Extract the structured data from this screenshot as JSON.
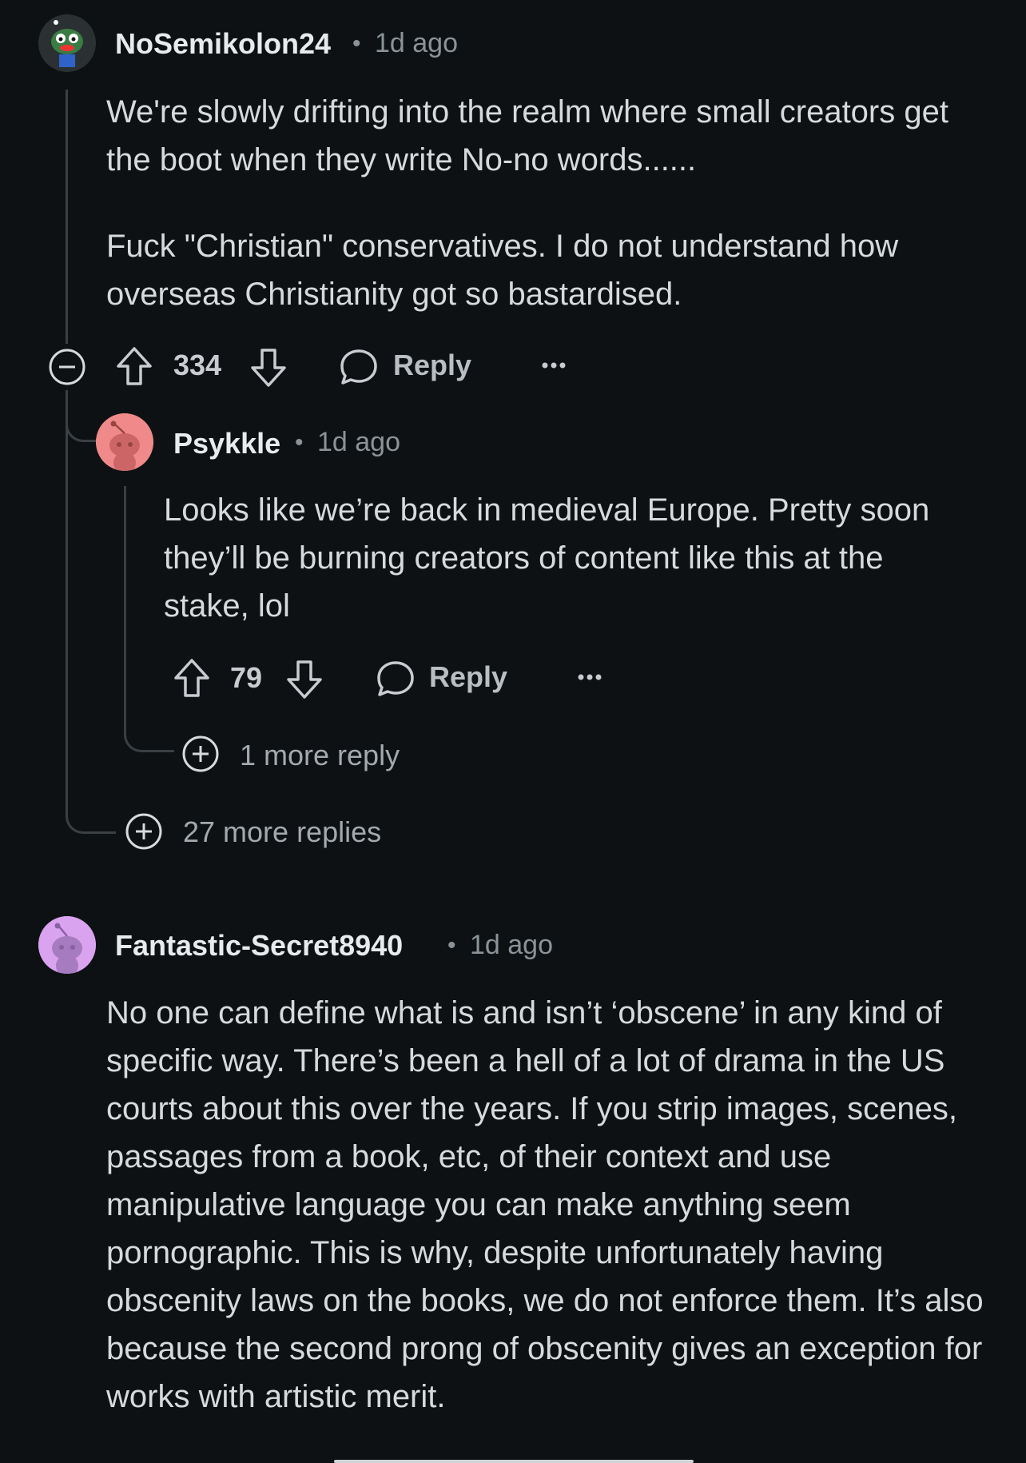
{
  "comments": [
    {
      "username": "NoSemikolon24",
      "separator": "•",
      "time": "1d ago",
      "paragraphs": [
        "We're slowly drifting into the realm where small creators get the boot when they write No-no words......",
        "Fuck \"Christian\" conservatives. I do not understand how overseas Christianity got so bastardised."
      ],
      "votes": "334",
      "reply_label": "Reply",
      "more_replies": "27 more replies",
      "avatar_color": "#3a7d44"
    },
    {
      "username": "Psykkle",
      "separator": "•",
      "time": "1d ago",
      "paragraphs": [
        "Looks like we’re back in medieval Europe. Pretty soon they’ll be burning creators of content like this at the stake, lol"
      ],
      "votes": "79",
      "reply_label": "Reply",
      "more_replies": "1 more reply",
      "avatar_color": "#f08a8a"
    },
    {
      "username": "Fantastic-Secret8940",
      "separator": "•",
      "time": "1d ago",
      "paragraphs": [
        "No one can define what is and isn’t ‘obscene’ in any kind of specific way. There’s been a hell of a lot of drama in the US courts about this over the years. If you strip images, scenes, passages from a book, etc, of their context and use manipulative language you can make anything seem pornographic. This is why, despite unfortunately having obscenity laws on the books, we do not enforce them. It’s also because the second prong of obscenity gives an exception for works with artistic merit."
      ],
      "avatar_color": "#d9a3f0"
    }
  ],
  "icons": {
    "collapse": "minus-circle-icon",
    "upvote": "upvote-arrow-icon",
    "downvote": "downvote-arrow-icon",
    "reply": "speech-bubble-icon",
    "more": "ellipsis-icon",
    "expand": "plus-circle-icon"
  }
}
